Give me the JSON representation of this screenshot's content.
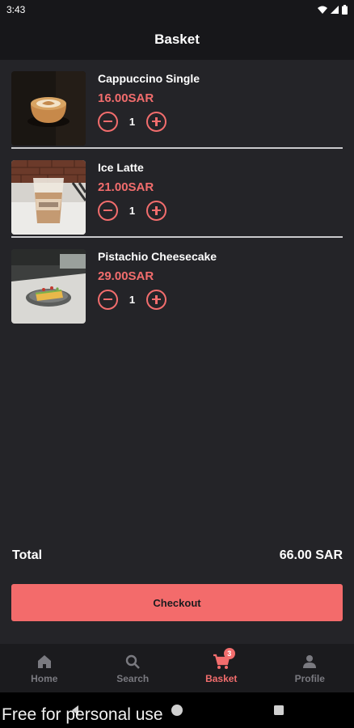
{
  "status_bar": {
    "time": "3:43"
  },
  "app_bar": {
    "title": "Basket"
  },
  "items": [
    {
      "name": "Cappuccino Single",
      "price": "16.00SAR",
      "quantity": "1",
      "image": "cappuccino-photo"
    },
    {
      "name": "Ice Latte",
      "price": "21.00SAR",
      "quantity": "1",
      "image": "ice-latte-photo"
    },
    {
      "name": "Pistachio Cheesecake",
      "price": "29.00SAR",
      "quantity": "1",
      "image": "cheesecake-photo"
    }
  ],
  "summary": {
    "total_label": "Total",
    "total_value": "66.00 SAR"
  },
  "checkout": {
    "label": "Checkout"
  },
  "bottom_nav": [
    {
      "label": "Home",
      "icon": "home-icon",
      "active": false
    },
    {
      "label": "Search",
      "icon": "search-icon",
      "active": false
    },
    {
      "label": "Basket",
      "icon": "cart-icon",
      "active": true,
      "badge": "3"
    },
    {
      "label": "Profile",
      "icon": "person-icon",
      "active": false
    }
  ],
  "watermark": "Free for personal use",
  "colors": {
    "accent": "#f26d6d",
    "background": "#242428",
    "bar": "#17171a"
  }
}
